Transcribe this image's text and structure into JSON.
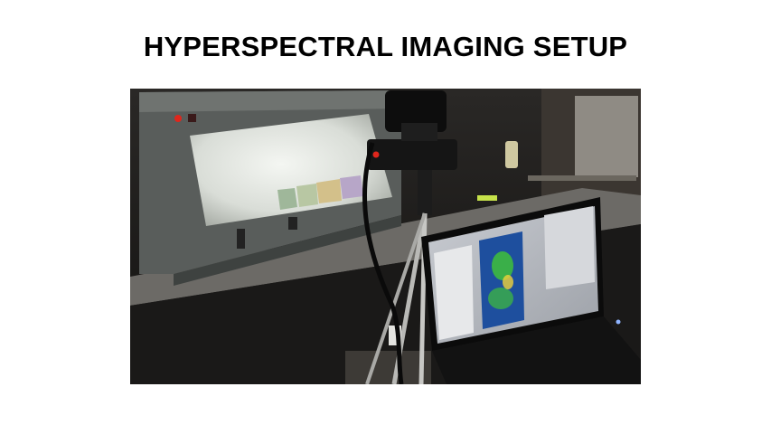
{
  "slide": {
    "title": "HYPERSPECTRAL IMAGING SETUP"
  },
  "photo": {
    "subject": "photo of hyperspectral imaging setup",
    "colors": {
      "background": "#161616",
      "lightbox_panel": "#e9ece8",
      "indicator_red": "#e0261c",
      "screen_heatmap": "#1e4f9e",
      "screen_green": "#3fbf3a"
    },
    "icons": [
      "camera-icon",
      "tripod-icon",
      "laptop-icon",
      "lightbox-icon"
    ]
  }
}
